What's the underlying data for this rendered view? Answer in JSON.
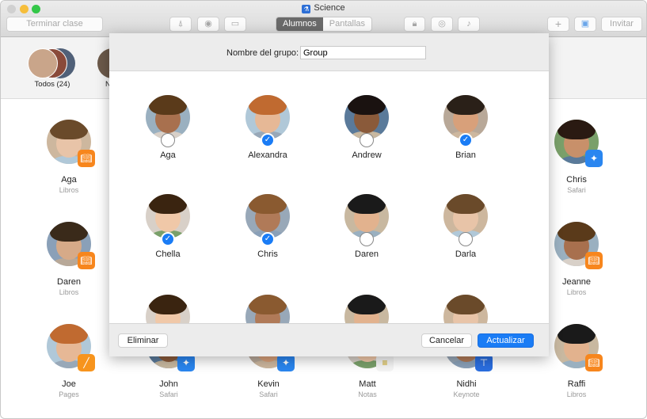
{
  "window": {
    "title": "Science"
  },
  "toolbar": {
    "end_class": "Terminar clase",
    "segments": [
      "Alumnos",
      "Pantallas"
    ],
    "invite": "Invitar",
    "icons": [
      "app-store-icon",
      "safari-compass-icon",
      "airplay-icon",
      "lock-icon",
      "eye-hide-icon",
      "mute-icon",
      "plus-icon",
      "inbox-icon"
    ]
  },
  "groups": {
    "all_label": "Todos (24)",
    "partial": "N"
  },
  "colors": {
    "accent": "#1a7cf5",
    "books": "#f7861d",
    "safari": "#2a86f0",
    "keynote": "#2a6ee0",
    "pages": "#f7941d"
  },
  "background_students": [
    {
      "name": "Aga",
      "app": "Libros",
      "badge": "books"
    },
    {
      "name": "Chris",
      "app": "Safari",
      "badge": "safari"
    },
    {
      "name": "Daren",
      "app": "Libros",
      "badge": "books"
    },
    {
      "name": "Jeanne",
      "app": "Libros",
      "badge": "books"
    },
    {
      "name": "Joe",
      "app": "Pages",
      "badge": "pages"
    },
    {
      "name": "John",
      "app": "Safari",
      "badge": "safari"
    },
    {
      "name": "Kevin",
      "app": "Safari",
      "badge": "safari"
    },
    {
      "name": "Matt",
      "app": "Notas",
      "badge": "notes"
    },
    {
      "name": "Nidhi",
      "app": "Keynote",
      "badge": "keynote"
    },
    {
      "name": "Raffi",
      "app": "Libros",
      "badge": "books"
    }
  ],
  "sheet": {
    "group_name_label": "Nombre del grupo:",
    "group_name_value": "Group",
    "students": [
      {
        "name": "Aga",
        "selected": false
      },
      {
        "name": "Alexandra",
        "selected": true
      },
      {
        "name": "Andrew",
        "selected": false
      },
      {
        "name": "Brian",
        "selected": true
      },
      {
        "name": "Chella",
        "selected": true
      },
      {
        "name": "Chris",
        "selected": true
      },
      {
        "name": "Daren",
        "selected": false
      },
      {
        "name": "Darla",
        "selected": false
      }
    ],
    "delete": "Eliminar",
    "cancel": "Cancelar",
    "update": "Actualizar"
  }
}
